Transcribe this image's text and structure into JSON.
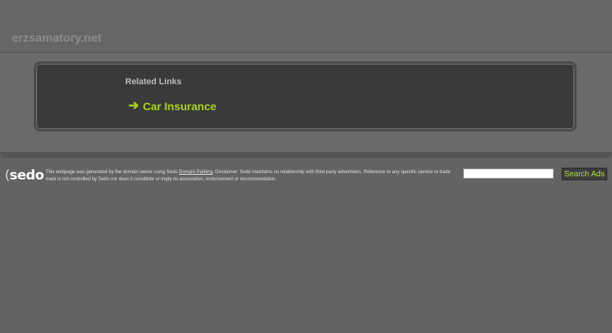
{
  "header": {
    "domain": "erzsamatory.net"
  },
  "related": {
    "heading": "Related Links",
    "links": [
      {
        "arrow": "➔",
        "label": "Car Insurance"
      }
    ]
  },
  "footer": {
    "logo_text": "sedo",
    "disclaimer_before": "This webpage was generated by the domain owner using Sedo ",
    "disclaimer_link": "Domain Parking",
    "disclaimer_after": ". Disclaimer: Sedo maintains no relationship with third party advertisers. Reference to any specific service or trade mark is not controlled by Sedo nor does it constitute or imply its association, endorsement or recommendation.",
    "search_value": "",
    "search_button": "Search Ads"
  },
  "colors": {
    "accent": "#a8d61a",
    "background": "#636363",
    "box": "#3a3a3a"
  }
}
